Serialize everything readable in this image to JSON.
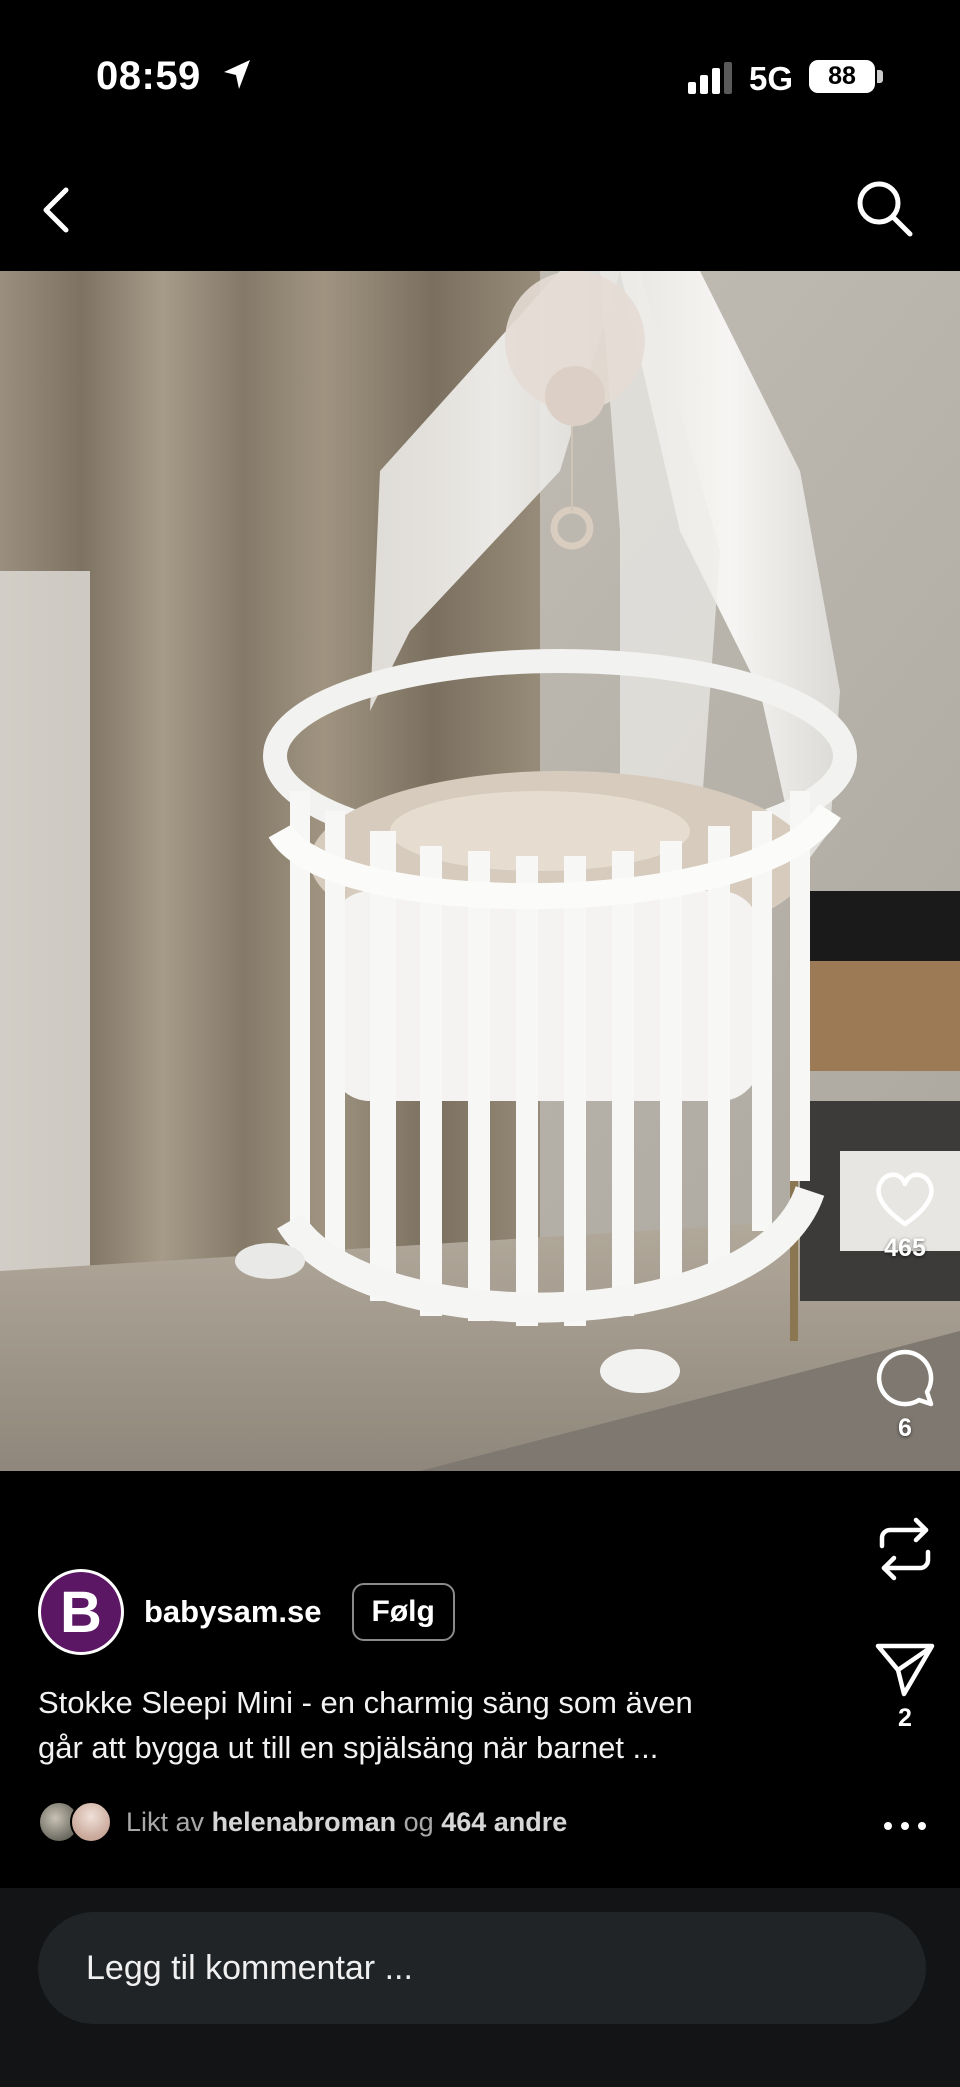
{
  "status_bar": {
    "time": "08:59",
    "network": "5G",
    "battery": "88"
  },
  "post": {
    "author": "babysam.se",
    "avatar_letter": "B",
    "follow_label": "Følg",
    "caption_line1": "Stokke Sleepi Mini - en charmig säng som även",
    "caption_line2": "går att bygga ut till en spjälsäng när barnet ...",
    "likes_prefix": "Likt av",
    "likes_user": "helenabroman",
    "likes_conj": "og",
    "likes_others": "464 andre"
  },
  "actions": {
    "like_count": "465",
    "comment_count": "6",
    "share_count": "2"
  },
  "comment": {
    "placeholder": "Legg til kommentar ..."
  },
  "icons": [
    "location-arrow-icon",
    "signal-icon",
    "back-icon",
    "search-icon",
    "heart-icon",
    "comment-icon",
    "repost-icon",
    "send-icon",
    "more-icon"
  ]
}
